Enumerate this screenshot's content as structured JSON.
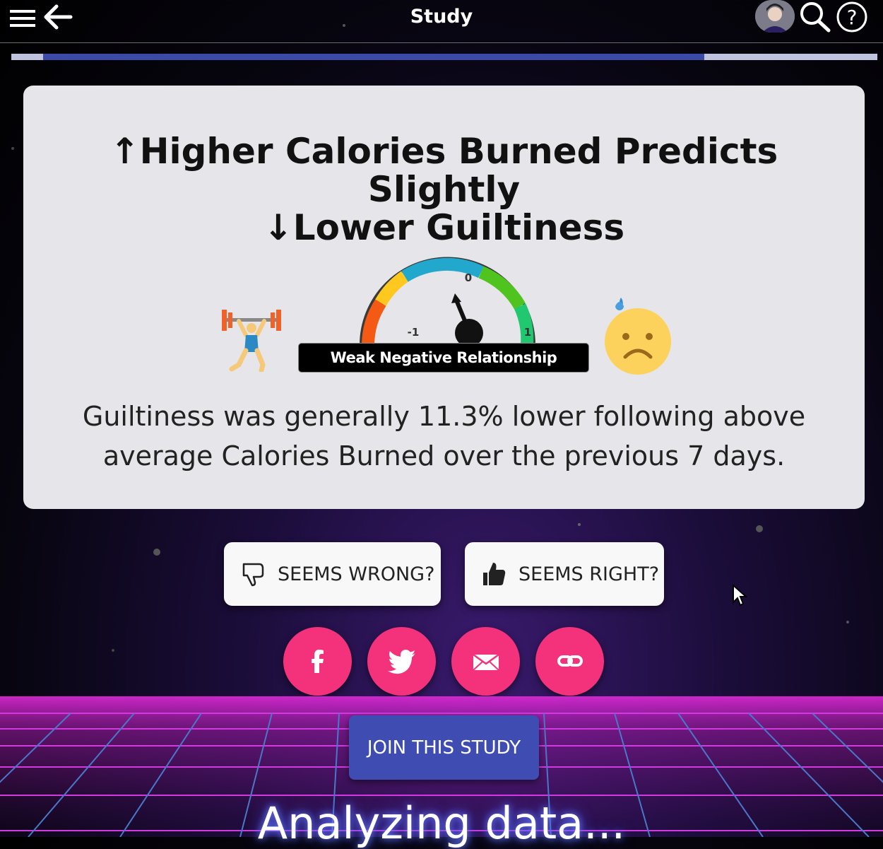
{
  "header": {
    "title": "Study",
    "icons": [
      "menu-icon",
      "back-arrow-icon",
      "avatar",
      "search-icon",
      "help-icon"
    ]
  },
  "progress": {
    "fraction": 0.8
  },
  "card": {
    "title_line1": "↑Higher Calories Burned Predicts Slightly",
    "title_line2": "↓Lower Guiltiness",
    "gauge": {
      "tick_min": "-1",
      "tick_mid": "0",
      "tick_max": "1",
      "label": "Weak Negative Relationship"
    },
    "description": "Guiltiness was generally 11.3% lower following above average Calories Burned over the previous 7 days."
  },
  "feedback": {
    "wrong_label": "SEEMS WRONG?",
    "right_label": "SEEMS RIGHT?"
  },
  "share": {
    "icons": [
      "facebook-icon",
      "twitter-icon",
      "email-icon",
      "link-icon"
    ],
    "color": "#f4327b"
  },
  "join_label": "JOIN THIS STUDY",
  "status_text": "Analyzing data..."
}
